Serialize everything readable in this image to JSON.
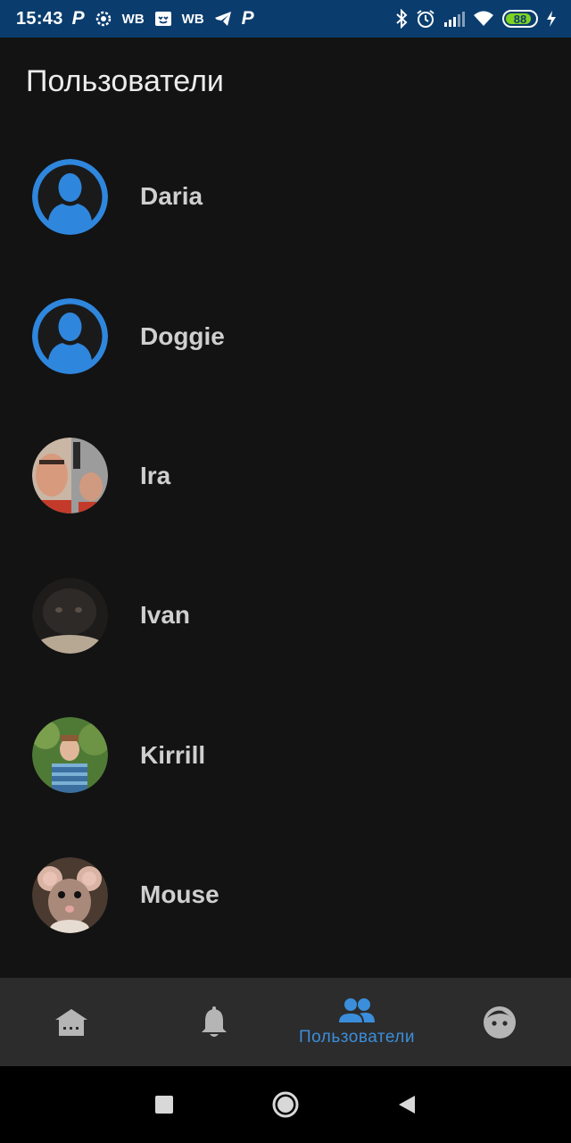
{
  "status_bar": {
    "time": "15:43",
    "wb1": "WB",
    "wb2": "WB",
    "battery": "88",
    "icons": [
      "parking-icon",
      "settings-gear-icon",
      "wb-icon",
      "cat-icon",
      "wb-icon",
      "telegram-icon",
      "parking-icon",
      "bluetooth-icon",
      "alarm-icon",
      "signal-icon",
      "wifi-icon",
      "battery-icon",
      "charging-icon"
    ]
  },
  "header": {
    "title": "Пользователи"
  },
  "users": [
    {
      "name": "Daria",
      "avatar": "default-avatar-icon"
    },
    {
      "name": "Doggie",
      "avatar": "default-avatar-icon"
    },
    {
      "name": "Ira",
      "avatar": "photo"
    },
    {
      "name": "Ivan",
      "avatar": "photo"
    },
    {
      "name": "Kirrill",
      "avatar": "photo"
    },
    {
      "name": "Mouse",
      "avatar": "photo"
    }
  ],
  "bottom_nav": {
    "items": [
      {
        "id": "home",
        "icon": "home-icon",
        "label": ""
      },
      {
        "id": "notifications",
        "icon": "bell-icon",
        "label": ""
      },
      {
        "id": "users",
        "icon": "people-icon",
        "label": "Пользователи",
        "active": true
      },
      {
        "id": "profile",
        "icon": "face-icon",
        "label": ""
      }
    ]
  },
  "colors": {
    "status_bar": "#0a3d6e",
    "background": "#131313",
    "nav_background": "#2c2c2c",
    "accent": "#3b8edb",
    "inactive_icon": "#b5b5b5"
  }
}
